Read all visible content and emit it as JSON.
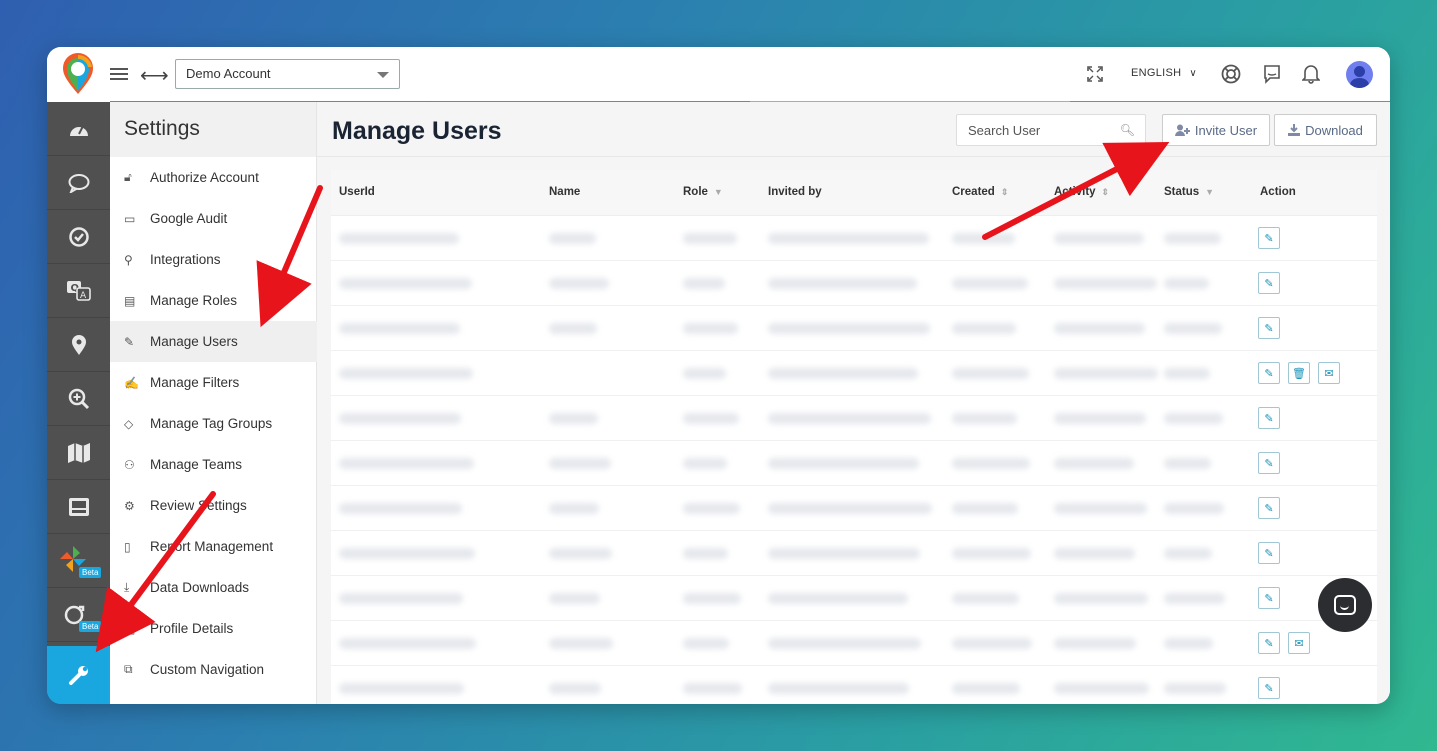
{
  "topbar": {
    "account": "Demo Account",
    "language": "ENGLISH",
    "icons": [
      "menu-icon",
      "expand-horizontal-icon",
      "fullscreen-icon",
      "help-icon",
      "chat-icon",
      "bell-icon",
      "avatar"
    ]
  },
  "colorline": [
    "#f05a28",
    "#1aa7e0",
    "#f2a21b",
    "#4cb050"
  ],
  "rail": {
    "items": [
      "dashboard-icon",
      "chat-bubble-icon",
      "check-circle-icon",
      "qa-icon",
      "location-pin-icon",
      "search-zoom-icon",
      "map-icon",
      "inbox-icon",
      "pinwheel-icon",
      "refresh-icon",
      "wrench-icon"
    ],
    "beta_label": "Beta"
  },
  "settings": {
    "title": "Settings",
    "items": [
      {
        "label": "Authorize Account",
        "icon": "lock-icon"
      },
      {
        "label": "Google Audit",
        "icon": "monitor-icon"
      },
      {
        "label": "Integrations",
        "icon": "plug-icon"
      },
      {
        "label": "Manage Roles",
        "icon": "document-icon"
      },
      {
        "label": "Manage Users",
        "icon": "pencil-icon"
      },
      {
        "label": "Manage Filters",
        "icon": "edit-box-icon"
      },
      {
        "label": "Manage Tag Groups",
        "icon": "tag-icon"
      },
      {
        "label": "Manage Teams",
        "icon": "team-icon"
      },
      {
        "label": "Review Settings",
        "icon": "gear-icon"
      },
      {
        "label": "Report Management",
        "icon": "file-icon"
      },
      {
        "label": "Data Downloads",
        "icon": "download-icon"
      },
      {
        "label": "Profile Details",
        "icon": "image-icon"
      },
      {
        "label": "Custom Navigation",
        "icon": "window-icon"
      }
    ]
  },
  "main": {
    "title": "Manage Users",
    "search_placeholder": "Search User",
    "invite_label": "Invite User",
    "download_label": "Download",
    "columns": [
      "UserId",
      "Name",
      "Role",
      "Invited by",
      "Created",
      "Activity",
      "Status",
      "Action"
    ],
    "row_actions": [
      [
        "edit"
      ],
      [
        "edit"
      ],
      [
        "edit"
      ],
      [
        "edit",
        "delete",
        "mail"
      ],
      [
        "edit"
      ],
      [
        "edit"
      ],
      [
        "edit"
      ],
      [
        "edit"
      ],
      [
        "edit"
      ],
      [
        "edit",
        "mail"
      ],
      [
        "edit"
      ]
    ]
  },
  "colors": {
    "accent": "#1aa7e0",
    "rail": "#505050",
    "arrow": "#e8141b"
  }
}
